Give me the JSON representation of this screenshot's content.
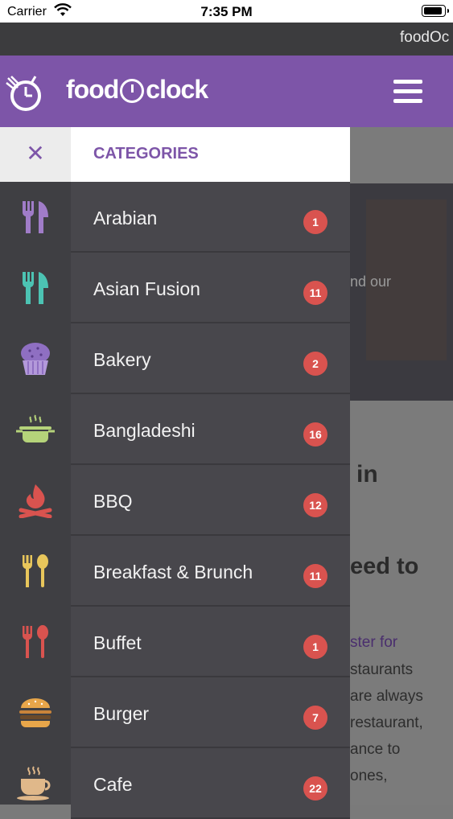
{
  "status_bar": {
    "carrier": "Carrier",
    "time": "7:35 PM"
  },
  "url_bar": {
    "text": "foodOc"
  },
  "header": {
    "logo_text_left": "food",
    "logo_text_right": "clock"
  },
  "drawer": {
    "close_symbol": "✕",
    "title": "CATEGORIES",
    "categories": [
      {
        "label": "Arabian",
        "count": "1",
        "icon": "utensils-icon",
        "icon_color": "#a07cc8"
      },
      {
        "label": "Asian Fusion",
        "count": "11",
        "icon": "utensils-icon",
        "icon_color": "#4cc3b3"
      },
      {
        "label": "Bakery",
        "count": "2",
        "icon": "cupcake-icon",
        "icon_color": "#8f6fc2"
      },
      {
        "label": "Bangladeshi",
        "count": "16",
        "icon": "cooking-pot-icon",
        "icon_color": "#b5d37a"
      },
      {
        "label": "BBQ",
        "count": "12",
        "icon": "campfire-icon",
        "icon_color": "#d9534f"
      },
      {
        "label": "Breakfast & Brunch",
        "count": "11",
        "icon": "fork-spoon-icon",
        "icon_color": "#e8c65b"
      },
      {
        "label": "Buffet",
        "count": "1",
        "icon": "fork-spoon-icon",
        "icon_color": "#d9534f"
      },
      {
        "label": "Burger",
        "count": "7",
        "icon": "burger-icon",
        "icon_color": "#e8a64a"
      },
      {
        "label": "Cafe",
        "count": "22",
        "icon": "coffee-cup-icon",
        "icon_color": "#e0b88a"
      }
    ]
  },
  "background_page": {
    "hero_text": "nd our",
    "heading_1": "in",
    "heading_2": "eed to",
    "link_text": "ster for",
    "para_1": "staurants",
    "para_2": "are always",
    "para_3": "restaurant,",
    "para_4": "ance to",
    "para_5": "ones,"
  },
  "colors": {
    "brand": "#7d55a8",
    "badge": "#d9534f",
    "drawer_item_bg": "#48474c"
  }
}
